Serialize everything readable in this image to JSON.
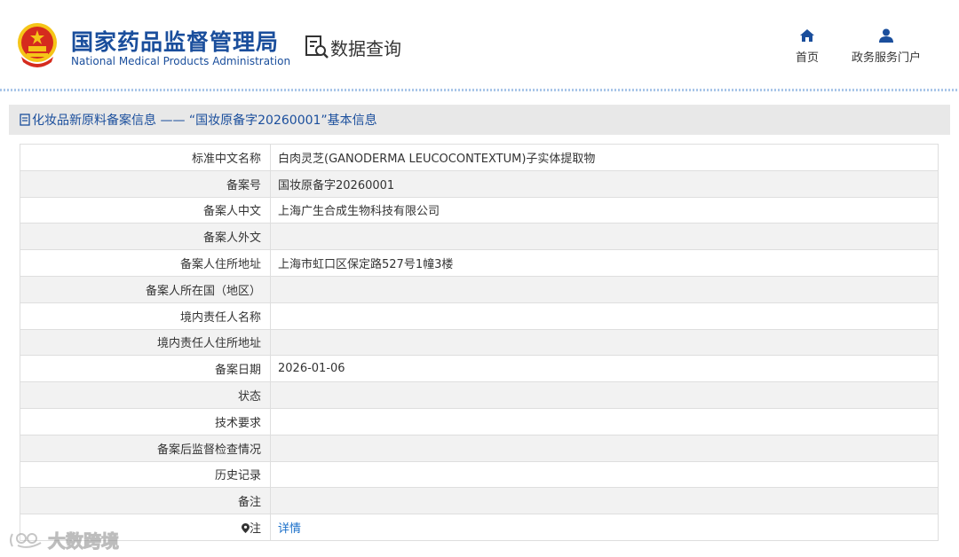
{
  "header": {
    "org_name_cn": "国家药品监督管理局",
    "org_name_en": "National Medical Products Administration",
    "data_query_label": "数据查询",
    "nav": {
      "home_label": "首页",
      "portal_label": "政务服务门户"
    }
  },
  "section": {
    "title": "化妆品新原料备案信息 —— “国妆原备字20260001”基本信息"
  },
  "table": {
    "rows": [
      {
        "label": "标准中文名称",
        "value": "白肉灵芝(GANODERMA LEUCOCONTEXTUM)子实体提取物"
      },
      {
        "label": "备案号",
        "value": "国妆原备字20260001"
      },
      {
        "label": "备案人中文",
        "value": "上海广生合成生物科技有限公司"
      },
      {
        "label": "备案人外文",
        "value": ""
      },
      {
        "label": "备案人住所地址",
        "value": "上海市虹口区保定路527号1幢3楼"
      },
      {
        "label": "备案人所在国（地区）",
        "value": ""
      },
      {
        "label": "境内责任人名称",
        "value": ""
      },
      {
        "label": "境内责任人住所地址",
        "value": ""
      },
      {
        "label": "备案日期",
        "value": "2026-01-06"
      },
      {
        "label": "状态",
        "value": ""
      },
      {
        "label": "技术要求",
        "value": ""
      },
      {
        "label": "备案后监督检查情况",
        "value": ""
      },
      {
        "label": "历史记录",
        "value": ""
      },
      {
        "label": "备注",
        "value": ""
      }
    ],
    "note_row": {
      "label": "注",
      "link_text": "详情",
      "icon": "location-pin-icon"
    }
  },
  "watermark": {
    "text": "大数跨境"
  },
  "colors": {
    "brand_blue": "#1a4e9c",
    "link_blue": "#1a6fc9",
    "section_bg": "#e8e8e8",
    "row_alt_bg": "#f2f2f2",
    "emblem_red": "#d52b1e",
    "emblem_gold": "#f5c518"
  }
}
